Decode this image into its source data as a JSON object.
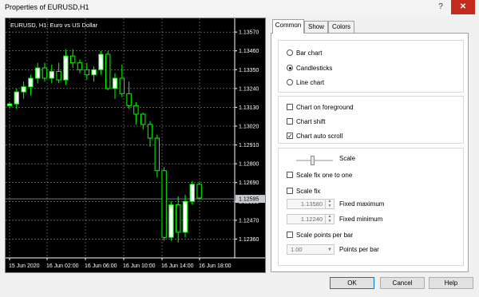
{
  "window": {
    "title": "Properties of EURUSD,H1",
    "help_glyph": "?",
    "close_glyph": "✕"
  },
  "chart": {
    "title": "EURUSD, H1:  Euro vs US Dollar",
    "current_price": "1.12595",
    "colors": {
      "background": "#000000",
      "bull": "#ffffff",
      "bear": "#000000",
      "wick": "#00ff00",
      "grid": "#8a8a8a",
      "price_line": "#7f8c9d"
    }
  },
  "chart_data": {
    "type": "candlestick",
    "symbol": "EURUSD",
    "timeframe": "H1",
    "y_ticks": [
      "1.13570",
      "1.13460",
      "1.13350",
      "1.13240",
      "1.13130",
      "1.13020",
      "1.12910",
      "1.12800",
      "1.12690",
      "1.12580",
      "1.12470",
      "1.12360"
    ],
    "x_ticks": [
      "15 Jun 2020",
      "16 Jun 02:00",
      "16 Jun 06:00",
      "16 Jun 10:00",
      "16 Jun 14:00",
      "16 Jun 18:00"
    ],
    "ylim": [
      1.1225,
      1.1365
    ],
    "grid": true,
    "candles": [
      {
        "o": 1.1314,
        "h": 1.1316,
        "l": 1.1313,
        "c": 1.1315
      },
      {
        "o": 1.1315,
        "h": 1.1324,
        "l": 1.1312,
        "c": 1.1322
      },
      {
        "o": 1.1322,
        "h": 1.1328,
        "l": 1.1318,
        "c": 1.1325
      },
      {
        "o": 1.1325,
        "h": 1.1332,
        "l": 1.132,
        "c": 1.133
      },
      {
        "o": 1.133,
        "h": 1.1339,
        "l": 1.1327,
        "c": 1.1336
      },
      {
        "o": 1.1336,
        "h": 1.1339,
        "l": 1.1328,
        "c": 1.133
      },
      {
        "o": 1.133,
        "h": 1.1338,
        "l": 1.1327,
        "c": 1.1334
      },
      {
        "o": 1.1334,
        "h": 1.1339,
        "l": 1.1327,
        "c": 1.1329
      },
      {
        "o": 1.1329,
        "h": 1.1347,
        "l": 1.1326,
        "c": 1.1343
      },
      {
        "o": 1.1343,
        "h": 1.1347,
        "l": 1.1336,
        "c": 1.1339
      },
      {
        "o": 1.1339,
        "h": 1.1341,
        "l": 1.1333,
        "c": 1.1335
      },
      {
        "o": 1.1335,
        "h": 1.1339,
        "l": 1.1329,
        "c": 1.1332
      },
      {
        "o": 1.1332,
        "h": 1.1337,
        "l": 1.1328,
        "c": 1.1335
      },
      {
        "o": 1.1335,
        "h": 1.1346,
        "l": 1.1332,
        "c": 1.1344
      },
      {
        "o": 1.1344,
        "h": 1.1346,
        "l": 1.1323,
        "c": 1.1324
      },
      {
        "o": 1.1324,
        "h": 1.1333,
        "l": 1.1318,
        "c": 1.133
      },
      {
        "o": 1.133,
        "h": 1.1338,
        "l": 1.1319,
        "c": 1.1321
      },
      {
        "o": 1.1321,
        "h": 1.1328,
        "l": 1.1312,
        "c": 1.1314
      },
      {
        "o": 1.1314,
        "h": 1.1316,
        "l": 1.1303,
        "c": 1.1309
      },
      {
        "o": 1.1309,
        "h": 1.131,
        "l": 1.13,
        "c": 1.1303
      },
      {
        "o": 1.1303,
        "h": 1.1305,
        "l": 1.129,
        "c": 1.1295
      },
      {
        "o": 1.1295,
        "h": 1.1297,
        "l": 1.1272,
        "c": 1.1276
      },
      {
        "o": 1.1276,
        "h": 1.1278,
        "l": 1.1235,
        "c": 1.1237
      },
      {
        "o": 1.1237,
        "h": 1.1258,
        "l": 1.1235,
        "c": 1.1256
      },
      {
        "o": 1.1256,
        "h": 1.1261,
        "l": 1.1234,
        "c": 1.124
      },
      {
        "o": 1.124,
        "h": 1.1262,
        "l": 1.1237,
        "c": 1.1258
      },
      {
        "o": 1.1258,
        "h": 1.127,
        "l": 1.1256,
        "c": 1.1268
      },
      {
        "o": 1.1268,
        "h": 1.1269,
        "l": 1.1259,
        "c": 1.126
      }
    ]
  },
  "tabs": [
    {
      "label": "Common",
      "active": true
    },
    {
      "label": "Show",
      "active": false
    },
    {
      "label": "Colors",
      "active": false
    }
  ],
  "common": {
    "chart_types": [
      {
        "label": "Bar chart",
        "selected": false
      },
      {
        "label": "Candlesticks",
        "selected": true
      },
      {
        "label": "Line chart",
        "selected": false
      }
    ],
    "options": [
      {
        "label": "Chart on foreground",
        "checked": false
      },
      {
        "label": "Chart shift",
        "checked": false
      },
      {
        "label": "Chart auto scroll",
        "checked": true
      }
    ],
    "scale": {
      "label": "Scale",
      "level": 0.4,
      "fix_one_to_one": {
        "label": "Scale fix one to one",
        "checked": false
      },
      "fix": {
        "label": "Scale fix",
        "checked": false
      },
      "fixed_maximum": {
        "value": "1.13580",
        "label": "Fixed maximum"
      },
      "fixed_minimum": {
        "value": "1.12240",
        "label": "Fixed minimum"
      },
      "points_per_bar_check": {
        "label": "Scale points per bar",
        "checked": false
      },
      "points_per_bar": {
        "value": "1.00",
        "label": "Points per bar"
      }
    }
  },
  "buttons": {
    "ok": "OK",
    "cancel": "Cancel",
    "help": "Help"
  }
}
